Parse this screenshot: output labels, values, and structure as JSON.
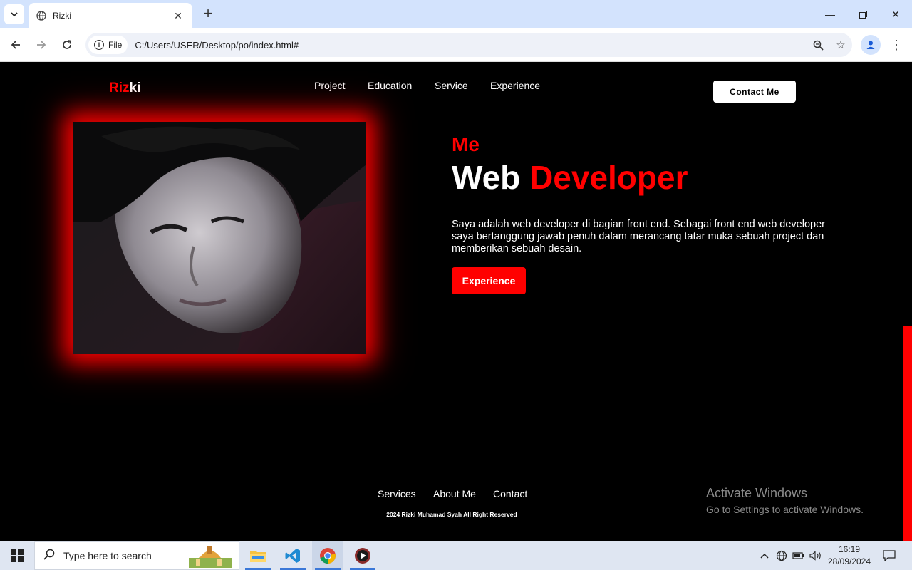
{
  "browser": {
    "tab_title": "Rizki",
    "url_chip": "File",
    "url": "C:/Users/USER/Desktop/po/index.html#"
  },
  "site": {
    "logo_red": "Riz",
    "logo_white": "ki",
    "nav": [
      "Project",
      "Education",
      "Service",
      "Experience"
    ],
    "contact_button": "Contact Me",
    "hero": {
      "eyebrow": "Me",
      "headline_white": "Web",
      "headline_red": "Developer",
      "description": "Saya adalah web developer di bagian front end. Sebagai front end web developer saya bertanggung jawab penuh dalam merancang tatar muka sebuah project dan memberikan sebuah desain.",
      "button": "Experience"
    },
    "footer": {
      "links": [
        "Services",
        "About Me",
        "Contact"
      ],
      "copyright": "2024 Rizki Muhamad Syah All Right Reserved"
    }
  },
  "watermark": {
    "title": "Activate Windows",
    "subtitle": "Go to Settings to activate Windows."
  },
  "taskbar": {
    "search_placeholder": "Type here to search",
    "time": "16:19",
    "date": "28/09/2024"
  },
  "colors": {
    "accent": "#ff0000",
    "background": "#000000",
    "chrome_tab_strip": "#d3e3fd"
  }
}
